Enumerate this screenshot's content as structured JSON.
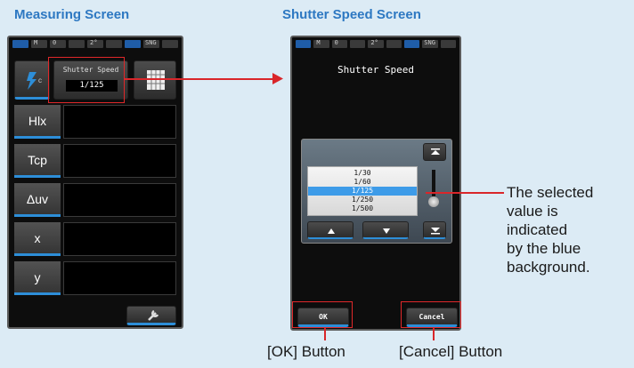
{
  "headings": {
    "left": "Measuring Screen",
    "right": "Shutter Speed Screen"
  },
  "measuring": {
    "mode_icon": "flash-icon",
    "shutter_label": "Shutter Speed",
    "shutter_value": "1/125",
    "rows": [
      {
        "label": "Hlx"
      },
      {
        "label": "Tcp"
      },
      {
        "label": "Δuv"
      },
      {
        "label": "x"
      },
      {
        "label": "y"
      }
    ],
    "tool_icon": "wrench-icon"
  },
  "shutter_screen": {
    "title": "Shutter Speed",
    "values": [
      "1/30",
      "1/60",
      "1/125",
      "1/250",
      "1/500"
    ],
    "selected_index": 2,
    "ok_label": "OK",
    "cancel_label": "Cancel"
  },
  "status_bar": {
    "items": [
      "M",
      "0",
      "2°",
      "SNG"
    ]
  },
  "annotations": {
    "selected_note": "The selected\nvalue is\nindicated\nby the blue\nbackground.",
    "ok_caption": "[OK] Button",
    "cancel_caption": "[Cancel] Button"
  },
  "colors": {
    "heading": "#2d78c2",
    "callout": "#d9262a",
    "selected": "#3d9be8",
    "accent": "#2d8ed8"
  }
}
